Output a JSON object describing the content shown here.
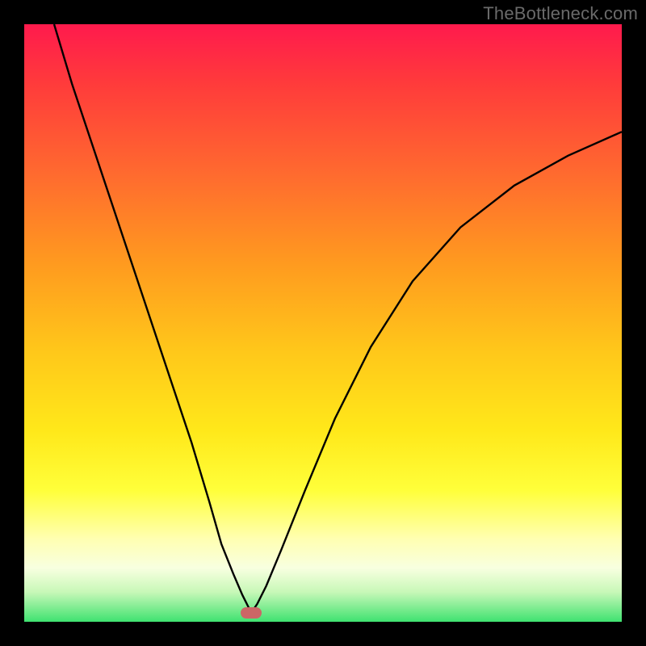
{
  "watermark": "TheBottleneck.com",
  "colors": {
    "background": "#000000",
    "curve": "#000000",
    "marker": "#cc6666",
    "gradient_top": "#ff1a4d",
    "gradient_bottom": "#3fe270"
  },
  "chart_data": {
    "type": "line",
    "title": "",
    "xlabel": "",
    "ylabel": "",
    "xlim": [
      0,
      100
    ],
    "ylim": [
      0,
      100
    ],
    "annotations": [
      {
        "text": "TheBottleneck.com",
        "x": 100,
        "y": 100,
        "anchor": "top-right"
      }
    ],
    "marker": {
      "x": 38,
      "y": 1.5
    },
    "series": [
      {
        "name": "left-branch",
        "x": [
          5,
          8,
          12,
          16,
          20,
          24,
          28,
          31,
          33,
          35,
          36.5,
          37.5,
          38
        ],
        "values": [
          100,
          90,
          78,
          66,
          54,
          42,
          30,
          20,
          13,
          8,
          4.5,
          2.5,
          1.5
        ]
      },
      {
        "name": "right-branch",
        "x": [
          38,
          39,
          40.5,
          43,
          47,
          52,
          58,
          65,
          73,
          82,
          91,
          100
        ],
        "values": [
          1.5,
          3,
          6,
          12,
          22,
          34,
          46,
          57,
          66,
          73,
          78,
          82
        ]
      }
    ]
  }
}
